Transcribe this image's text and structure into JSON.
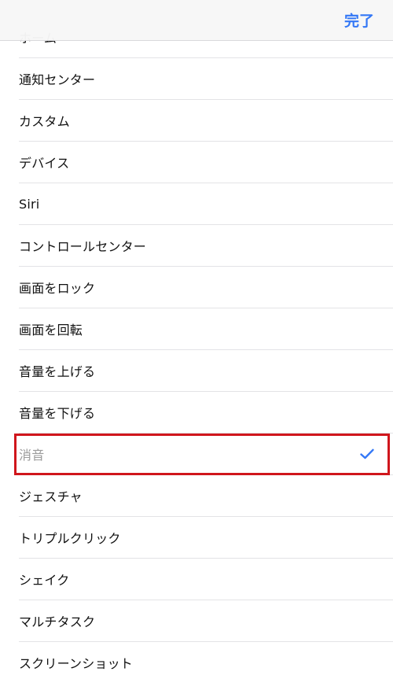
{
  "nav": {
    "done_label": "完了"
  },
  "list": {
    "items": [
      {
        "label": "ホーム"
      },
      {
        "label": "通知センター"
      },
      {
        "label": "カスタム"
      },
      {
        "label": "デバイス"
      },
      {
        "label": "Siri"
      },
      {
        "label": "コントロールセンター"
      },
      {
        "label": "画面をロック"
      },
      {
        "label": "画面を回転"
      },
      {
        "label": "音量を上げる"
      },
      {
        "label": "音量を下げる"
      },
      {
        "label": "消音",
        "selected": true
      },
      {
        "label": "ジェスチャ"
      },
      {
        "label": "トリプルクリック"
      },
      {
        "label": "シェイク"
      },
      {
        "label": "マルチタスク"
      },
      {
        "label": "スクリーンショット"
      }
    ]
  },
  "colors": {
    "accent": "#3478f6",
    "highlight_border": "#d0161c",
    "selected_text": "#9b9b9b"
  },
  "icons": {
    "selected_marker": "checkmark-icon"
  }
}
